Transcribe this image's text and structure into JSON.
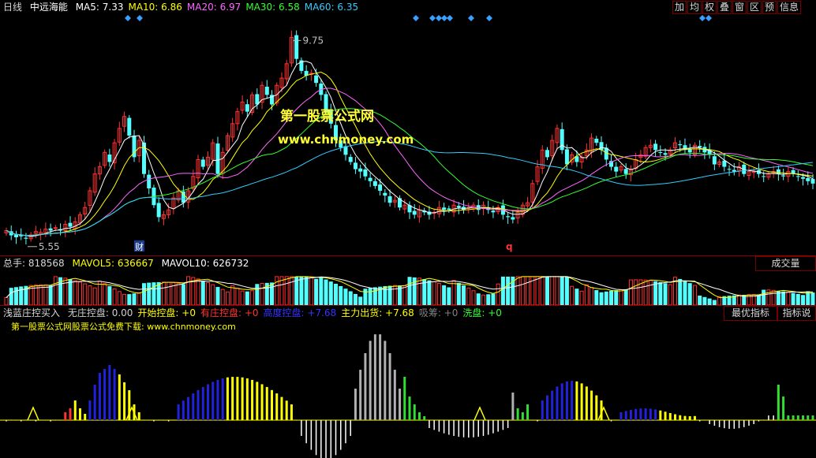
{
  "header": {
    "period": "日线",
    "stock_name": "中远海能",
    "ma": [
      {
        "label": "MA5: 7.33",
        "color": "#ffffff"
      },
      {
        "label": "MA10: 6.86",
        "color": "#ffff00"
      },
      {
        "label": "MA20: 6.97",
        "color": "#ff66ff"
      },
      {
        "label": "MA30: 6.58",
        "color": "#33ff33"
      },
      {
        "label": "MA60: 6.35",
        "color": "#33ccff"
      }
    ]
  },
  "toolbar": [
    "加",
    "均",
    "权",
    "叠",
    "窗",
    "区",
    "预",
    "信息"
  ],
  "price_chart": {
    "high_label": "9.75",
    "low_label": "5.55",
    "marker_cai": "财",
    "marker_q": "q",
    "watermark_title": "第一股票公式网",
    "watermark_url": "www.chnmoney.com",
    "ylim": [
      5.3,
      10.2
    ]
  },
  "volume_panel": {
    "total_label": "总手: 818568",
    "mavol5_label": "MAVOL5: 636667",
    "mavol10_label": "MAVOL10: 626732",
    "button": "成交量"
  },
  "indicator_panel": {
    "title": "浅蓝庄控买入",
    "items": [
      {
        "label": "无庄控盘: 0.00",
        "color": "#d0d0d0"
      },
      {
        "label": "开始控盘: +0",
        "color": "#ffff00"
      },
      {
        "label": "有庄控盘: +0",
        "color": "#ff3333"
      },
      {
        "label": "高度控盘: +7.68",
        "color": "#3333ff"
      },
      {
        "label": "主力出货: +7.68",
        "color": "#ffff00"
      },
      {
        "label": "吸筹: +0",
        "color": "#808080"
      },
      {
        "label": "洗盘: +0",
        "color": "#33ff33"
      }
    ],
    "subtitle": "第一股票公式网股票公式免费下载: www.chnmoney.com",
    "btn_best": "最优指标",
    "btn_help": "指标说明"
  },
  "colors": {
    "up": "#ff3333",
    "down": "#54ffff",
    "border": "#8b0000",
    "diamond": "#3aa0ff"
  },
  "chart_data": {
    "type": "candlestick",
    "closes": [
      5.72,
      5.62,
      5.58,
      5.6,
      5.55,
      5.63,
      5.7,
      5.68,
      5.75,
      5.72,
      5.78,
      5.72,
      5.85,
      5.8,
      5.9,
      6.05,
      6.2,
      6.55,
      6.9,
      7.05,
      7.35,
      7.15,
      7.55,
      7.85,
      8.1,
      7.7,
      7.25,
      7.6,
      6.9,
      6.6,
      6.25,
      6.0,
      6.05,
      6.15,
      6.4,
      6.55,
      6.3,
      6.55,
      6.85,
      7.2,
      7.05,
      7.25,
      7.55,
      6.9,
      7.35,
      7.7,
      7.95,
      8.2,
      8.4,
      8.2,
      8.55,
      8.35,
      8.75,
      8.55,
      8.35,
      8.75,
      8.9,
      9.2,
      9.75,
      9.3,
      9.05,
      8.95,
      9.0,
      8.8,
      8.55,
      8.2,
      7.95,
      7.6,
      7.45,
      7.3,
      7.15,
      7.0,
      6.95,
      6.85,
      6.75,
      6.65,
      6.55,
      6.45,
      6.3,
      6.35,
      6.2,
      6.25,
      6.1,
      6.05,
      6.15,
      6.1,
      6.05,
      6.1,
      6.2,
      6.15,
      6.15,
      6.25,
      6.2,
      6.15,
      6.2,
      6.25,
      6.15,
      6.25,
      6.15,
      6.1,
      6.2,
      6.05,
      6.0,
      5.95,
      6.1,
      6.25,
      6.3,
      6.7,
      7.05,
      7.4,
      7.25,
      7.6,
      7.85,
      7.4,
      7.1,
      7.3,
      7.15,
      7.25,
      7.4,
      7.65,
      7.55,
      7.4,
      7.2,
      7.05,
      6.95,
      7.05,
      6.9,
      7.0,
      7.2,
      7.3,
      7.45,
      7.5,
      7.4,
      7.35,
      7.3,
      7.4,
      7.55,
      7.5,
      7.4,
      7.35,
      7.5,
      7.45,
      7.35,
      7.3,
      7.1,
      7.15,
      7.05,
      7.0,
      6.95,
      7.05,
      6.9,
      6.95,
      6.95,
      6.9,
      6.85,
      6.9,
      6.95,
      6.9,
      6.85,
      6.95,
      6.9,
      6.85,
      6.8,
      6.75,
      6.7
    ],
    "high_value": 9.75,
    "low_value": 5.55
  }
}
